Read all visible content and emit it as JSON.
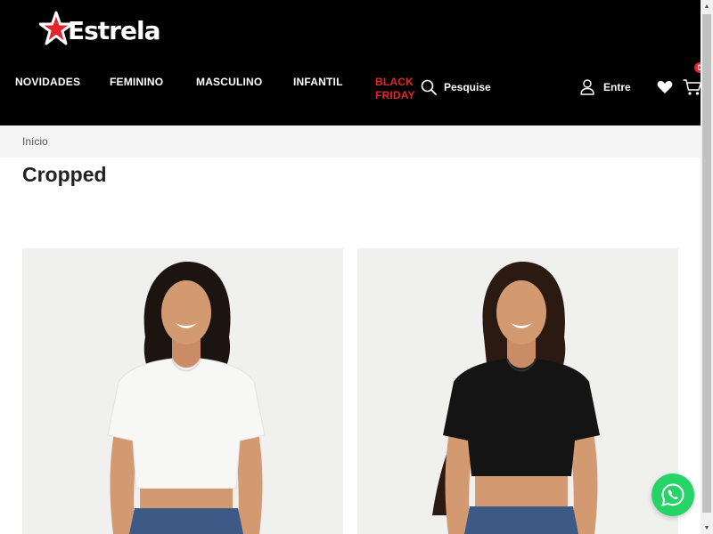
{
  "brand": {
    "name": "Estrela",
    "accent": "#e3262b"
  },
  "nav": {
    "items": [
      {
        "label": "NOVIDADES"
      },
      {
        "label": "FEMININO"
      },
      {
        "label": "MASCULINO"
      },
      {
        "label": "INFANTIL"
      }
    ],
    "black_friday_line1": "BLACK",
    "black_friday_line2": "FRIDAY"
  },
  "search": {
    "label": "Pesquise",
    "icon": "search-icon"
  },
  "account": {
    "label": "Entre",
    "icon": "user-icon"
  },
  "wishlist": {
    "icon": "heart-icon"
  },
  "cart": {
    "icon": "cart-icon",
    "count": "0"
  },
  "breadcrumb": {
    "home": "Início"
  },
  "page": {
    "title": "Cropped"
  },
  "products": [
    {
      "shirt_color": "#f4f4f2",
      "image": "product-image-white-cropped"
    },
    {
      "shirt_color": "#111111",
      "image": "product-image-black-cropped"
    }
  ],
  "whatsapp": {
    "icon": "whatsapp-icon",
    "color": "#25d366"
  }
}
